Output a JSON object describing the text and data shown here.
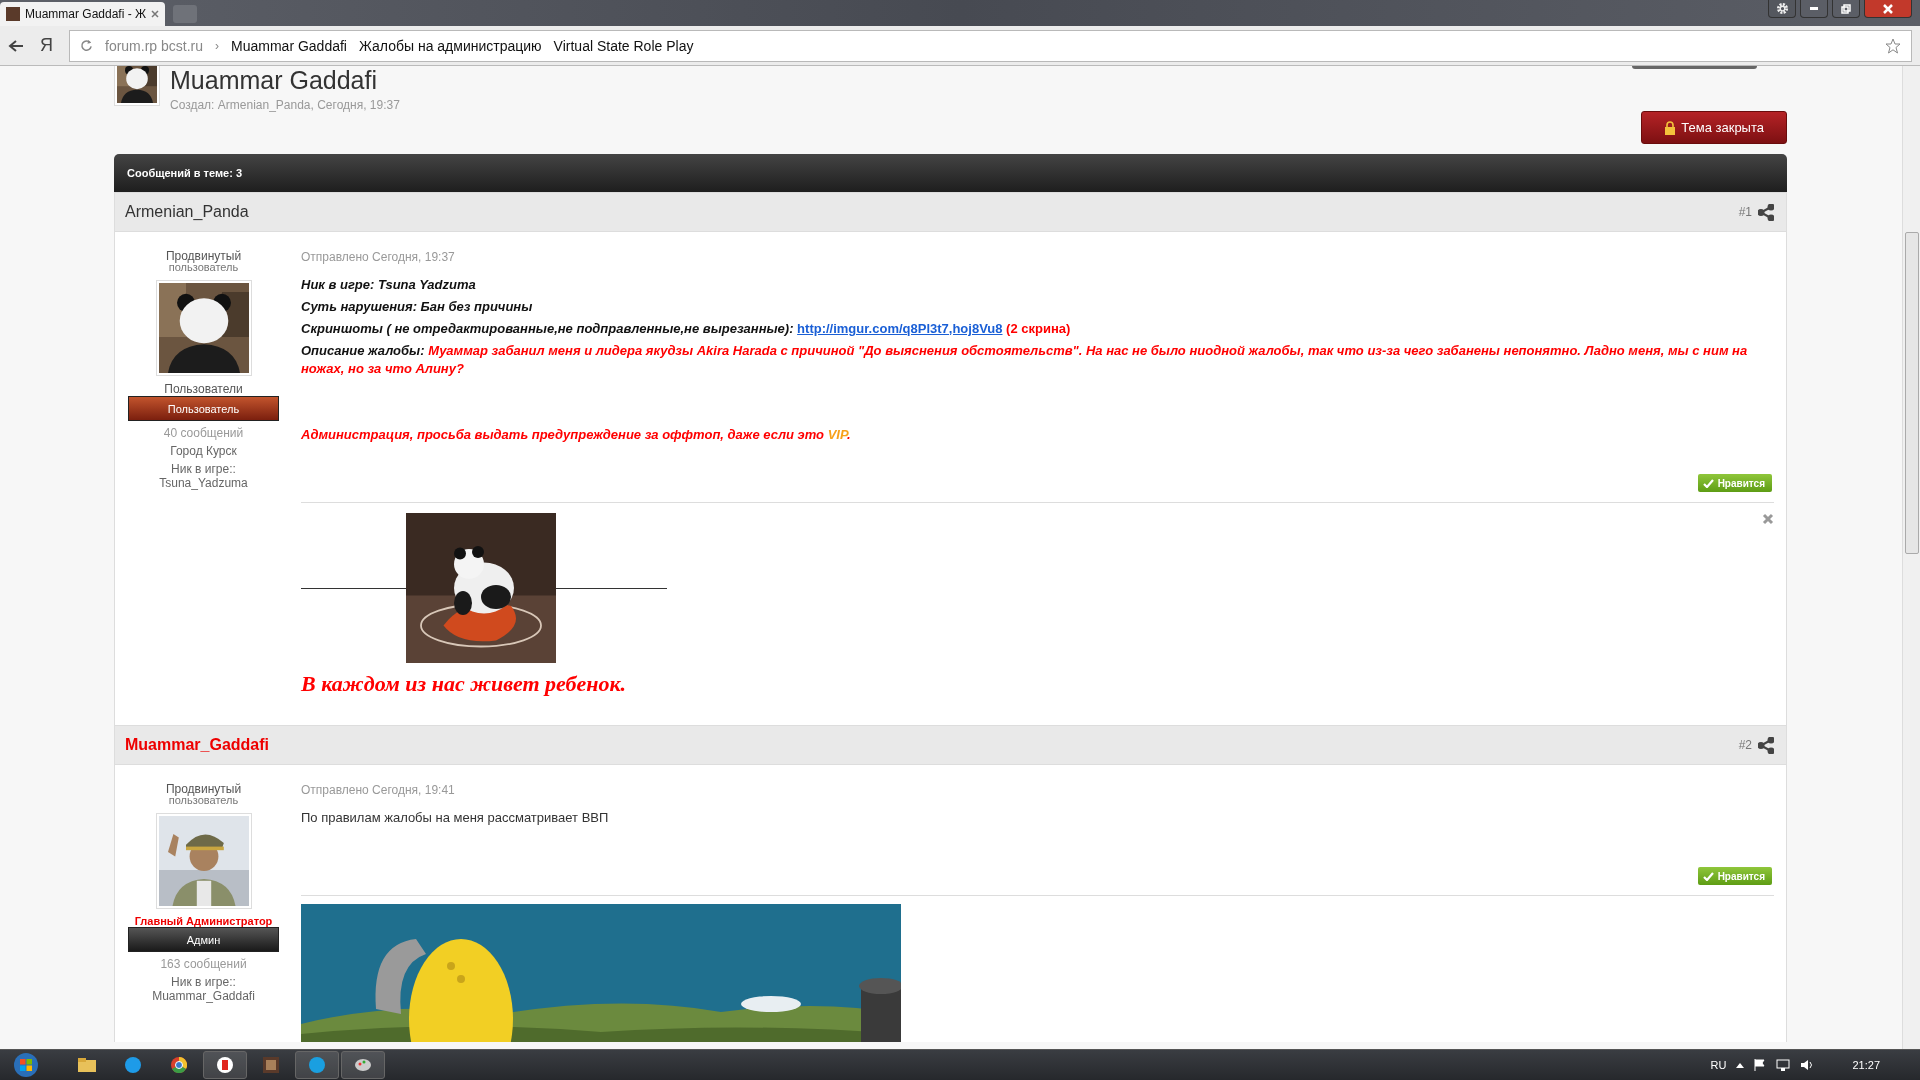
{
  "browser": {
    "tab_title": "Muammar Gaddafi - Ж",
    "home_key": "Я",
    "address": {
      "host": "forum.rp bcst.ru",
      "separator": "›",
      "crumbs": [
        "Muammar Gaddafi",
        "Жалобы на администрацию",
        "Virtual State Role Play"
      ]
    }
  },
  "thread": {
    "title": "Muammar Gaddafi",
    "created": "Создал: Armenian_Panda, Сегодня, 19:37",
    "closed_button": "Тема закрыта",
    "count": "Сообщений в теме: 3"
  },
  "posts": [
    {
      "kind": "member",
      "author": "Armenian_Panda",
      "number": "#1",
      "rank": "Продвинутый",
      "rank_sub": "пользователь",
      "group": "Пользователи",
      "badge": "Пользователь",
      "messages": "40 сообщений",
      "info": [
        "Город Курск",
        "Ник в игре:: Tsuna_Yadzuma"
      ],
      "date": "Отправлено Сегодня, 19:37",
      "paragraphs": [
        {
          "runs": [
            {
              "kind": "label",
              "text": "Ник в игре: Tsuna Yadzuma"
            }
          ]
        },
        {
          "runs": [
            {
              "kind": "label",
              "text": "Суть нарушения: Бан без причины"
            }
          ]
        },
        {
          "runs": [
            {
              "kind": "label",
              "text": "Скриншоты ( не отредактированные,не подправленные,не вырезанные): "
            },
            {
              "kind": "link",
              "text": "http://imgur.com/q8Pl3t7,hoj8Vu8"
            },
            {
              "kind": "note",
              "text": " (2 скрина)"
            }
          ]
        },
        {
          "runs": [
            {
              "kind": "label",
              "text": "Описание жалобы: "
            },
            {
              "kind": "value",
              "text": "Муаммар забанил меня и лидера якудзы Akira Harada  с причиной \"До выяснения обстоятельств\". На нас не было ниодной жалобы, так что из-за чего забанены непонятно. Ладно меня, мы с ним на ножах, но за что Алину?"
            }
          ]
        },
        {
          "runs": [
            {
              "kind": "value",
              "text": "Администрация, просьба выдать предупреждение за оффтоп, даже если это "
            },
            {
              "kind": "vip",
              "text": "VIP"
            },
            {
              "kind": "value",
              "text": "."
            }
          ]
        }
      ],
      "like": "Нравится",
      "signature": {
        "text": "В каждом из нас живет ребенок."
      }
    },
    {
      "kind": "admin",
      "author": "Muammar_Gaddafi",
      "number": "#2",
      "rank": "Продвинутый",
      "rank_sub": "пользователь",
      "group": "Главный Администратор",
      "badge": "Админ",
      "messages": "163 сообщений",
      "info": [
        "Ник в игре:: Muammar_Gaddafi"
      ],
      "date": "Отправлено Сегодня, 19:41",
      "paragraphs": [
        {
          "runs": [
            {
              "kind": "plain",
              "text": "По правилам жалобы на меня рассматривает ВВП"
            }
          ]
        }
      ],
      "like": "Нравится",
      "attachment": {
        "kind": "picture"
      }
    }
  ],
  "taskbar": {
    "language": "RU",
    "clock": "21:27"
  }
}
